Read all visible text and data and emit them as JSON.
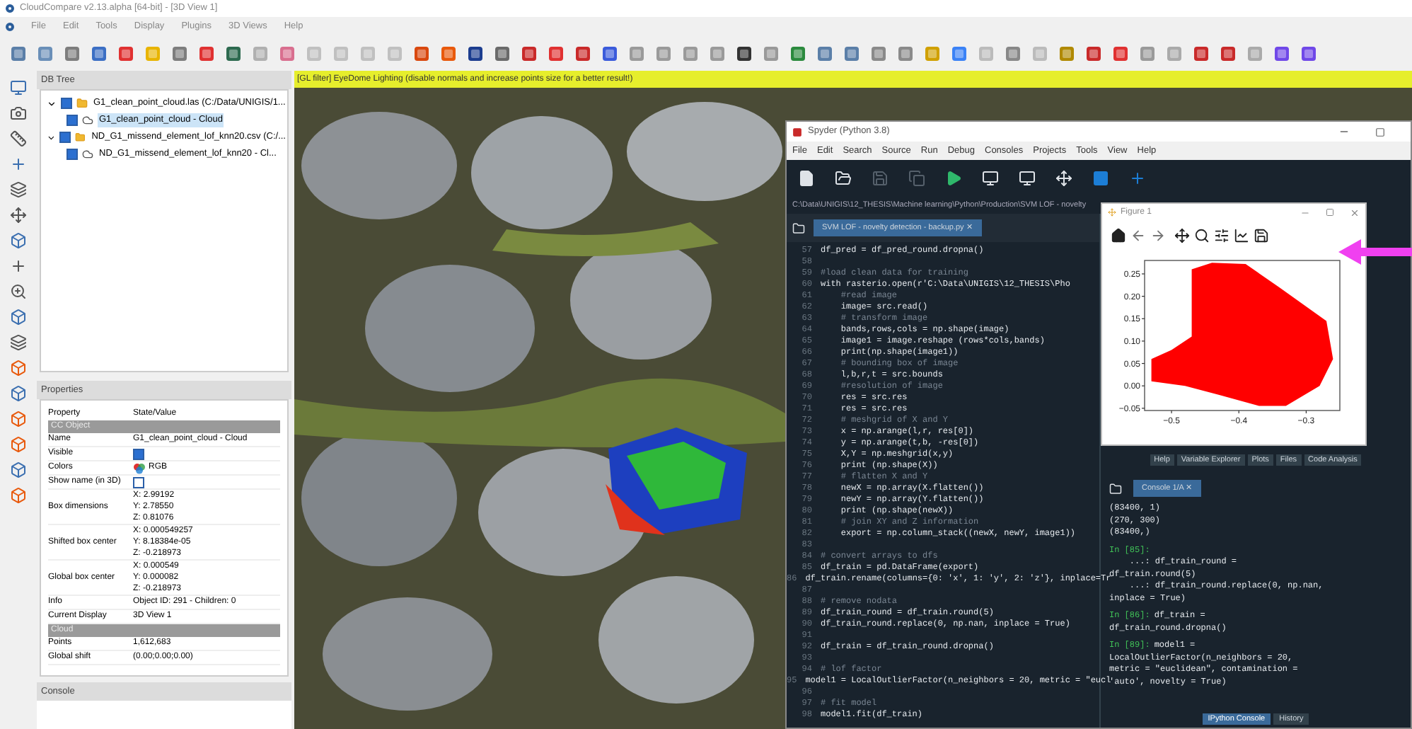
{
  "cloudcompare": {
    "title": "CloudCompare v2.13.alpha [64-bit] - [3D View 1]",
    "menu": [
      "File",
      "Edit",
      "Tools",
      "Display",
      "Plugins",
      "3D Views",
      "Help"
    ],
    "db_tree": {
      "title": "DB Tree",
      "items": [
        {
          "label": "G1_clean_point_cloud.las (C:/Data/UNIGIS/1...",
          "kind": "file",
          "checked": true,
          "expanded": true,
          "selected": false,
          "children": [
            {
              "label": "G1_clean_point_cloud - Cloud",
              "kind": "cloud",
              "checked": true,
              "selected": true
            }
          ]
        },
        {
          "label": "ND_G1_missend_element_lof_knn20.csv (C:/...",
          "kind": "file",
          "checked": true,
          "expanded": true,
          "selected": false,
          "children": [
            {
              "label": "ND_G1_missend_element_lof_knn20 - Cl...",
              "kind": "cloud",
              "checked": true,
              "selected": false
            }
          ]
        }
      ]
    },
    "properties": {
      "title": "Properties",
      "columns": [
        "Property",
        "State/Value"
      ],
      "rows": [
        {
          "kind": "section",
          "label": "CC Object"
        },
        {
          "kind": "text",
          "name": "Name",
          "value": "G1_clean_point_cloud - Cloud"
        },
        {
          "kind": "check",
          "name": "Visible",
          "checked": true
        },
        {
          "kind": "colors",
          "name": "Colors",
          "value": "RGB"
        },
        {
          "kind": "check",
          "name": "Show name (in 3D)",
          "checked": false
        },
        {
          "kind": "multi",
          "name": "Box dimensions",
          "values": [
            "X: 2.99192",
            "Y: 2.78550",
            "Z: 0.81076"
          ]
        },
        {
          "kind": "multi",
          "name": "Shifted box center",
          "values": [
            "X: 0.000549257",
            "Y: 8.18384e-05",
            "Z: -0.218973"
          ]
        },
        {
          "kind": "multi",
          "name": "Global box center",
          "values": [
            "X: 0.000549",
            "Y: 0.000082",
            "Z: -0.218973"
          ]
        },
        {
          "kind": "text",
          "name": "Info",
          "value": "Object ID: 291 - Children: 0"
        },
        {
          "kind": "text",
          "name": "Current Display",
          "value": "3D View 1"
        },
        {
          "kind": "section",
          "label": "Cloud"
        },
        {
          "kind": "text",
          "name": "Points",
          "value": "1,612,683"
        },
        {
          "kind": "text",
          "name": "Global shift",
          "value": "(0.00;0.00;0.00)"
        }
      ]
    },
    "console": {
      "title": "Console"
    },
    "view": {
      "banner": "[GL filter] EyeDome Lighting (disable normals and increase points size for a better result!)"
    }
  },
  "spyder": {
    "title": "Spyder (Python 3.8)",
    "menu": [
      "File",
      "Edit",
      "Search",
      "Source",
      "Run",
      "Debug",
      "Consoles",
      "Projects",
      "Tools",
      "View",
      "Help"
    ],
    "path": "C:\\Data\\UNIGIS\\12_THESIS\\Machine learning\\Python\\Production\\SVM LOF - novelty",
    "editor_tab": {
      "label": "SVM LOF - novelty detection - backup.py",
      "close": "✕"
    },
    "code": [
      {
        "n": "57",
        "kind": "code",
        "text": "df_pred = df_pred_round.dropna()"
      },
      {
        "n": "58",
        "kind": "blank"
      },
      {
        "n": "59",
        "kind": "comment",
        "text": "#load clean data for training"
      },
      {
        "n": "60",
        "kind": "code",
        "text": "with rasterio.open(r'C:\\Data\\UNIGIS\\12_THESIS\\Pho"
      },
      {
        "n": "61",
        "kind": "comment",
        "text": "    #read image"
      },
      {
        "n": "62",
        "kind": "code",
        "text": "    image= src.read()"
      },
      {
        "n": "63",
        "kind": "comment",
        "text": "    # transform image"
      },
      {
        "n": "64",
        "kind": "code",
        "text": "    bands,rows,cols = np.shape(image)"
      },
      {
        "n": "65",
        "kind": "code",
        "text": "    image1 = image.reshape (rows*cols,bands)"
      },
      {
        "n": "66",
        "kind": "code",
        "text": "    print(np.shape(image1))"
      },
      {
        "n": "67",
        "kind": "comment",
        "text": "    # bounding box of image"
      },
      {
        "n": "68",
        "kind": "code",
        "text": "    l,b,r,t = src.bounds"
      },
      {
        "n": "69",
        "kind": "comment",
        "text": "    #resolution of image"
      },
      {
        "n": "70",
        "kind": "code",
        "text": "    res = src.res"
      },
      {
        "n": "71",
        "kind": "code",
        "text": "    res = src.res"
      },
      {
        "n": "72",
        "kind": "comment",
        "text": "    # meshgrid of X and Y"
      },
      {
        "n": "73",
        "kind": "code",
        "text": "    x = np.arange(l,r, res[0])"
      },
      {
        "n": "74",
        "kind": "code",
        "text": "    y = np.arange(t,b, -res[0])"
      },
      {
        "n": "75",
        "kind": "code",
        "text": "    X,Y = np.meshgrid(x,y)"
      },
      {
        "n": "76",
        "kind": "code",
        "text": "    print (np.shape(X))"
      },
      {
        "n": "77",
        "kind": "comment",
        "text": "    # flatten X and Y"
      },
      {
        "n": "78",
        "kind": "code",
        "text": "    newX = np.array(X.flatten())"
      },
      {
        "n": "79",
        "kind": "code",
        "text": "    newY = np.array(Y.flatten())"
      },
      {
        "n": "80",
        "kind": "code",
        "text": "    print (np.shape(newX))"
      },
      {
        "n": "81",
        "kind": "comment",
        "text": "    # join XY and Z information"
      },
      {
        "n": "82",
        "kind": "code",
        "text": "    export = np.column_stack((newX, newY, image1))"
      },
      {
        "n": "83",
        "kind": "blank"
      },
      {
        "n": "84",
        "kind": "comment",
        "text": "# convert arrays to dfs"
      },
      {
        "n": "85",
        "kind": "code",
        "text": "df_train = pd.DataFrame(export)"
      },
      {
        "n": "86",
        "kind": "code",
        "text": "df_train.rename(columns={0: 'x', 1: 'y', 2: 'z'}, inplace=Tr"
      },
      {
        "n": "87",
        "kind": "blank"
      },
      {
        "n": "88",
        "kind": "comment",
        "text": "# remove nodata"
      },
      {
        "n": "89",
        "kind": "code",
        "text": "df_train_round = df_train.round(5)"
      },
      {
        "n": "90",
        "kind": "code",
        "text": "df_train_round.replace(0, np.nan, inplace = True)"
      },
      {
        "n": "91",
        "kind": "blank"
      },
      {
        "n": "92",
        "kind": "code",
        "text": "df_train = df_train_round.dropna()"
      },
      {
        "n": "93",
        "kind": "blank"
      },
      {
        "n": "94",
        "kind": "comment",
        "text": "# lof factor"
      },
      {
        "n": "95",
        "kind": "code",
        "text": "model1 = LocalOutlierFactor(n_neighbors = 20, metric = \"eucl"
      },
      {
        "n": "96",
        "kind": "blank"
      },
      {
        "n": "97",
        "kind": "comment",
        "text": "# fit model"
      },
      {
        "n": "98",
        "kind": "code",
        "text": "model1.fit(df_train)"
      }
    ],
    "pane_tabs": [
      "Help",
      "Variable Explorer",
      "Plots",
      "Files",
      "Code Analysis"
    ],
    "console_tab": {
      "label": "Console 1/A",
      "close": "✕"
    },
    "console_lines": [
      {
        "kind": "out",
        "text": "(83400, 1)"
      },
      {
        "kind": "out",
        "text": "(270, 300)"
      },
      {
        "kind": "out",
        "text": "(83400,)"
      },
      {
        "kind": "prompt",
        "prompt": "In [85]:"
      },
      {
        "kind": "out",
        "text": "    ...: df_train_round ="
      },
      {
        "kind": "out",
        "text": "df_train.round(5)"
      },
      {
        "kind": "out",
        "text": "    ...: df_train_round.replace(0, np.nan,"
      },
      {
        "kind": "out",
        "text": "inplace = True)"
      },
      {
        "kind": "prompt",
        "prompt": "In [86]:",
        "text": "df_train ="
      },
      {
        "kind": "out",
        "text": "df_train_round.dropna()"
      },
      {
        "kind": "prompt",
        "prompt": "In [89]:",
        "text": "model1 ="
      },
      {
        "kind": "out",
        "text": "LocalOutlierFactor(n_neighbors = 20,"
      },
      {
        "kind": "out",
        "text": "metric = \"euclidean\", contamination ="
      },
      {
        "kind": "out",
        "text": "'auto', novelty = True)"
      }
    ],
    "bottom_tabs": [
      {
        "label": "IPython Console",
        "selected": true
      },
      {
        "label": "History",
        "selected": false
      }
    ]
  },
  "figure": {
    "title": "Figure 1",
    "y_tick_labels": [
      "0.25",
      "0.20",
      "0.15",
      "0.10",
      "0.05",
      "0.00",
      "−0.05"
    ],
    "x_tick_labels": [
      "−0.5",
      "−0.4",
      "−0.3"
    ]
  }
}
